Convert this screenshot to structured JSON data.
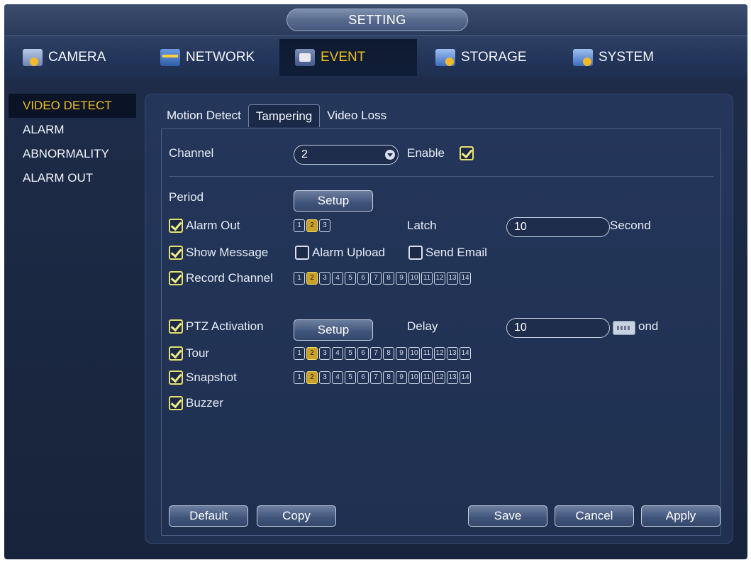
{
  "window": {
    "title": "SETTING"
  },
  "nav": {
    "tabs": [
      {
        "label": "CAMERA",
        "icon": "camera-icon"
      },
      {
        "label": "NETWORK",
        "icon": "network-icon"
      },
      {
        "label": "EVENT",
        "icon": "event-icon",
        "active": true
      },
      {
        "label": "STORAGE",
        "icon": "storage-icon"
      },
      {
        "label": "SYSTEM",
        "icon": "system-icon"
      }
    ]
  },
  "sidebar": {
    "items": [
      {
        "label": "VIDEO DETECT",
        "active": true
      },
      {
        "label": "ALARM"
      },
      {
        "label": "ABNORMALITY"
      },
      {
        "label": "ALARM OUT"
      }
    ]
  },
  "subtabs": [
    {
      "label": "Motion Detect"
    },
    {
      "label": "Tampering",
      "active": true
    },
    {
      "label": "Video Loss"
    }
  ],
  "form": {
    "channel_label": "Channel",
    "channel_value": "2",
    "enable_label": "Enable",
    "enable_checked": true,
    "period_label": "Period",
    "setup_label": "Setup",
    "alarm_out_label": "Alarm Out",
    "alarm_out_channels": [
      "1",
      "2",
      "3"
    ],
    "alarm_out_selected": "2",
    "latch_label": "Latch",
    "latch_value": "10",
    "second_label": "Second",
    "show_message_label": "Show Message",
    "alarm_upload_label": "Alarm Upload",
    "send_email_label": "Send Email",
    "record_channel_label": "Record Channel",
    "channels_14": [
      "1",
      "2",
      "3",
      "4",
      "5",
      "6",
      "7",
      "8",
      "9",
      "10",
      "11",
      "12",
      "13",
      "14"
    ],
    "selected_channel": "2",
    "ptz_activation_label": "PTZ Activation",
    "ptz_setup_label": "Setup",
    "delay_label": "Delay",
    "delay_value": "10",
    "delay_unit_partial": "ond",
    "tour_label": "Tour",
    "snapshot_label": "Snapshot",
    "buzzer_label": "Buzzer"
  },
  "buttons": {
    "default": "Default",
    "copy": "Copy",
    "save": "Save",
    "cancel": "Cancel",
    "apply": "Apply"
  },
  "colors": {
    "active_accent": "#f0c020",
    "background": "#1f2e4d"
  }
}
